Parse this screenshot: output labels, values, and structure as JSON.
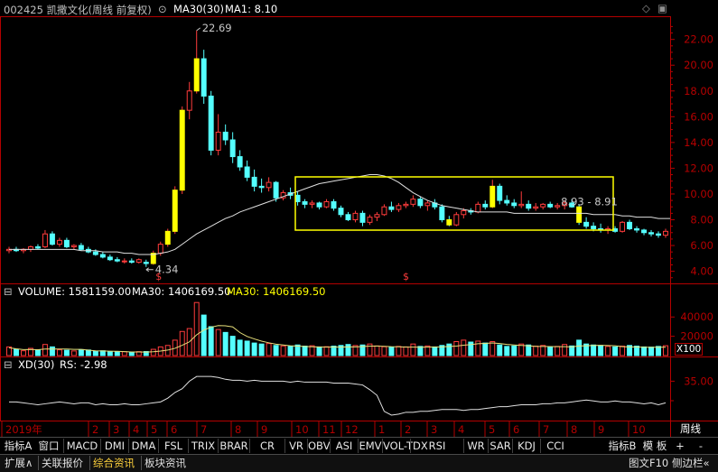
{
  "header": {
    "code": "002425",
    "name": "凯撒文化(周线 前复权)",
    "ma_label": "MA30(30)",
    "ma1_label": "MA1: 8.10"
  },
  "volume_header": {
    "title": "VOLUME: 1581159.00",
    "ma_label": "MA30: 1406169.50",
    "ma_value": "MA30: 1406169.50"
  },
  "xd_header": {
    "title": "XD(30)",
    "rs": "RS: -2.98"
  },
  "annotations": {
    "high": "22.69",
    "low": "4.34",
    "range": "8.93 - 8.91",
    "marker": "$"
  },
  "scale": {
    "vol_unit": "X100",
    "period": "周线"
  },
  "toolbar": {
    "expand": "指标A",
    "window": "窗口",
    "indicators": [
      "MACD",
      "DMI",
      "DMA",
      "FSL",
      "TRIX",
      "BRAR",
      "CR",
      "VR",
      "OBV",
      "ASI",
      "EMV",
      "VOL-TDX",
      "RSI",
      "WR",
      "SAR",
      "KDJ",
      "CCI"
    ],
    "indicator_b": "指标B",
    "template": "模 板",
    "plus": "+",
    "minus": "-"
  },
  "bottom_tabs": {
    "expand": "扩展∧",
    "items": [
      "关联报价",
      "综合资讯",
      "板块资讯"
    ],
    "f10": "图文F10",
    "sidebar": "侧边栏«"
  },
  "colors": {
    "up": "#ff3c3c",
    "down": "#54ffff",
    "ma": "#e0e0e0",
    "ma30_label": "#ffff00",
    "axis": "#b40000",
    "box": "#ffff00"
  },
  "chart_data": [
    {
      "type": "candlestick",
      "title": "002425 凯撒文化(周线 前复权)",
      "ylim": [
        3.2,
        23.8
      ],
      "y_ticks": [
        "22.00",
        "20.00",
        "18.00",
        "16.00",
        "14.00",
        "12.00",
        "10.00",
        "8.00",
        "6.00",
        "4.00"
      ],
      "x_labels": [
        "2019年",
        "2",
        "3",
        "4",
        "5",
        "6",
        "7",
        "8",
        "9",
        "10",
        "11",
        "12",
        "1",
        "2",
        "3",
        "4",
        "5",
        "6",
        "7",
        "8",
        "9",
        "10"
      ],
      "ohlc": [
        [
          5.6,
          5.9,
          5.4,
          5.7
        ],
        [
          5.7,
          5.9,
          5.5,
          5.6
        ],
        [
          5.6,
          5.8,
          5.4,
          5.7
        ],
        [
          5.7,
          6.0,
          5.5,
          5.9
        ],
        [
          5.9,
          6.1,
          5.7,
          5.8
        ],
        [
          5.9,
          7.2,
          5.8,
          6.9
        ],
        [
          6.9,
          7.1,
          6.0,
          6.1
        ],
        [
          6.1,
          6.6,
          5.9,
          6.4
        ],
        [
          6.4,
          6.6,
          5.8,
          5.9
        ],
        [
          5.9,
          6.1,
          5.7,
          6.0
        ],
        [
          6.0,
          6.2,
          5.6,
          5.7
        ],
        [
          5.7,
          5.9,
          5.4,
          5.5
        ],
        [
          5.5,
          5.7,
          5.2,
          5.3
        ],
        [
          5.3,
          5.5,
          5.0,
          5.1
        ],
        [
          5.1,
          5.3,
          4.8,
          4.9
        ],
        [
          4.9,
          5.1,
          4.7,
          4.8
        ],
        [
          4.8,
          5.0,
          4.6,
          4.8
        ],
        [
          4.8,
          5.0,
          4.6,
          4.7
        ],
        [
          4.7,
          5.0,
          4.6,
          4.9
        ],
        [
          4.7,
          4.9,
          4.34,
          4.6
        ],
        [
          4.6,
          5.6,
          4.5,
          5.4
        ],
        [
          5.4,
          6.3,
          5.2,
          6.1
        ],
        [
          6.1,
          7.3,
          5.9,
          7.1
        ],
        [
          7.1,
          10.6,
          6.9,
          10.3
        ],
        [
          10.3,
          16.8,
          10.0,
          16.5
        ],
        [
          16.5,
          18.7,
          15.8,
          18.0
        ],
        [
          18.0,
          22.69,
          17.8,
          20.5
        ],
        [
          20.5,
          21.2,
          17.0,
          17.6
        ],
        [
          17.6,
          18.0,
          13.0,
          13.4
        ],
        [
          13.4,
          16.2,
          13.0,
          14.8
        ],
        [
          14.8,
          15.4,
          13.8,
          14.2
        ],
        [
          14.2,
          14.8,
          12.4,
          12.9
        ],
        [
          12.9,
          13.4,
          11.8,
          12.1
        ],
        [
          12.1,
          12.6,
          11.0,
          11.3
        ],
        [
          11.3,
          11.9,
          10.2,
          10.6
        ],
        [
          10.6,
          11.2,
          10.1,
          10.5
        ],
        [
          10.5,
          11.3,
          10.2,
          10.9
        ],
        [
          10.9,
          11.0,
          9.4,
          9.7
        ],
        [
          9.7,
          10.3,
          9.5,
          10.1
        ],
        [
          10.1,
          10.5,
          9.6,
          9.9
        ],
        [
          9.9,
          10.2,
          9.1,
          9.4
        ],
        [
          9.4,
          9.6,
          8.9,
          9.2
        ],
        [
          9.2,
          9.5,
          8.9,
          9.3
        ],
        [
          9.3,
          9.4,
          8.8,
          9.0
        ],
        [
          9.0,
          9.6,
          8.9,
          9.4
        ],
        [
          9.4,
          9.6,
          8.7,
          8.9
        ],
        [
          8.9,
          9.1,
          8.2,
          8.4
        ],
        [
          8.4,
          8.6,
          7.9,
          8.0
        ],
        [
          8.0,
          8.7,
          7.8,
          8.5
        ],
        [
          8.5,
          8.7,
          7.5,
          7.8
        ],
        [
          7.8,
          8.4,
          7.6,
          8.2
        ],
        [
          8.2,
          8.6,
          7.9,
          8.4
        ],
        [
          8.4,
          9.2,
          8.3,
          9.0
        ],
        [
          9.0,
          9.4,
          8.6,
          8.8
        ],
        [
          8.8,
          9.3,
          8.6,
          9.1
        ],
        [
          9.1,
          9.4,
          8.9,
          9.2
        ],
        [
          9.2,
          9.9,
          9.0,
          9.6
        ],
        [
          9.6,
          9.8,
          8.9,
          9.1
        ],
        [
          9.1,
          9.5,
          8.7,
          9.3
        ],
        [
          9.3,
          9.6,
          8.8,
          9.0
        ],
        [
          9.0,
          9.2,
          7.8,
          8.0
        ],
        [
          8.0,
          8.3,
          7.5,
          7.6
        ],
        [
          7.6,
          8.6,
          7.5,
          8.4
        ],
        [
          8.4,
          8.9,
          8.1,
          8.7
        ],
        [
          8.7,
          8.9,
          8.4,
          8.6
        ],
        [
          8.6,
          9.4,
          8.5,
          9.2
        ],
        [
          9.2,
          9.5,
          8.8,
          9.0
        ],
        [
          9.0,
          11.1,
          8.9,
          10.6
        ],
        [
          10.6,
          10.8,
          9.2,
          9.5
        ],
        [
          9.5,
          9.9,
          9.1,
          9.3
        ],
        [
          9.3,
          9.6,
          8.9,
          9.1
        ],
        [
          9.1,
          10.2,
          8.9,
          9.2
        ],
        [
          9.2,
          9.5,
          8.7,
          8.9
        ],
        [
          8.9,
          9.3,
          8.7,
          9.0
        ],
        [
          9.0,
          9.3,
          8.8,
          9.2
        ],
        [
          9.2,
          9.4,
          8.9,
          9.0
        ],
        [
          9.0,
          9.3,
          8.8,
          9.1
        ],
        [
          9.1,
          9.5,
          8.8,
          9.3
        ],
        [
          9.3,
          9.6,
          8.93,
          9.0
        ],
        [
          9.0,
          9.2,
          7.6,
          7.8
        ],
        [
          7.8,
          8.2,
          7.3,
          7.5
        ],
        [
          7.5,
          7.8,
          7.1,
          7.3
        ],
        [
          7.3,
          7.7,
          7.0,
          7.2
        ],
        [
          7.2,
          7.5,
          6.9,
          7.3
        ],
        [
          7.3,
          7.5,
          7.0,
          7.1
        ],
        [
          7.1,
          7.9,
          7.0,
          7.8
        ],
        [
          7.8,
          8.0,
          7.2,
          7.3
        ],
        [
          7.3,
          7.5,
          7.0,
          7.2
        ],
        [
          7.2,
          7.3,
          6.8,
          7.0
        ],
        [
          7.0,
          7.2,
          6.7,
          6.9
        ],
        [
          6.9,
          7.1,
          6.6,
          6.8
        ],
        [
          6.8,
          7.3,
          6.6,
          7.1
        ]
      ],
      "series": [
        {
          "name": "MA30(30)",
          "values": [
            5.7,
            5.7,
            5.7,
            5.7,
            5.7,
            5.7,
            5.7,
            5.7,
            5.7,
            5.7,
            5.6,
            5.6,
            5.6,
            5.5,
            5.5,
            5.5,
            5.4,
            5.4,
            5.3,
            5.3,
            5.3,
            5.4,
            5.5,
            5.7,
            6.1,
            6.5,
            6.9,
            7.2,
            7.5,
            7.8,
            8.1,
            8.3,
            8.6,
            8.8,
            9.0,
            9.2,
            9.4,
            9.6,
            9.8,
            10.0,
            10.2,
            10.4,
            10.6,
            10.8,
            10.9,
            11.0,
            11.1,
            11.2,
            11.3,
            11.4,
            11.5,
            11.5,
            11.4,
            11.2,
            10.9,
            10.5,
            10.1,
            9.8,
            9.5,
            9.3,
            9.1,
            9.0,
            8.9,
            8.8,
            8.7,
            8.6,
            8.6,
            8.6,
            8.6,
            8.6,
            8.5,
            8.5,
            8.5,
            8.5,
            8.5,
            8.5,
            8.5,
            8.5,
            8.5,
            8.5,
            8.5,
            8.4,
            8.4,
            8.4,
            8.4,
            8.3,
            8.3,
            8.2,
            8.2,
            8.2,
            8.1,
            8.1
          ]
        }
      ],
      "annotations": [
        {
          "label": "22.69",
          "x_index": 26,
          "y": 22.69
        },
        {
          "label": "4.34",
          "x_index": 19,
          "y": 4.34
        },
        {
          "label": "8.93 - 8.91",
          "x_index": 78,
          "y": 9.4
        }
      ]
    },
    {
      "type": "bar",
      "title": "VOLUME",
      "y_ticks": [
        "40000",
        "20000"
      ],
      "unit": "X100",
      "values": [
        9000,
        6500,
        5000,
        7500,
        6000,
        11500,
        9000,
        6000,
        5500,
        4800,
        6200,
        5800,
        4500,
        5000,
        4200,
        3800,
        4000,
        3600,
        4100,
        4200,
        6500,
        9000,
        10500,
        16000,
        25000,
        28000,
        55000,
        42000,
        30000,
        27000,
        24000,
        20000,
        16000,
        15000,
        13000,
        12000,
        12500,
        10500,
        10000,
        9500,
        11000,
        9800,
        10200,
        9000,
        9200,
        9800,
        10500,
        11500,
        10400,
        11000,
        12000,
        10000,
        9200,
        8800,
        9500,
        9000,
        12000,
        9500,
        10000,
        9000,
        10500,
        12000,
        14500,
        16000,
        14000,
        15000,
        13000,
        14500,
        11000,
        9500,
        10000,
        12000,
        11000,
        9800,
        10500,
        9000,
        9500,
        11500,
        10000,
        16000,
        12000,
        11000,
        10500,
        9500,
        9000,
        9800,
        10500,
        9800,
        9000,
        8800,
        9500,
        10200
      ],
      "ma": 14061.7
    },
    {
      "type": "line",
      "title": "XD(30)",
      "y_ticks": [
        "35.00"
      ],
      "series": [
        {
          "name": "XD(30)",
          "values": [
            13,
            13,
            12,
            11,
            10,
            11,
            12,
            13,
            12,
            11,
            12,
            12,
            10,
            11,
            10,
            10,
            11,
            10,
            10,
            11,
            12,
            13,
            17,
            23,
            27,
            35,
            40,
            40,
            40,
            39,
            37,
            36,
            36,
            35,
            36,
            35,
            35,
            35,
            35,
            34,
            35,
            34,
            34,
            34,
            34,
            33,
            33,
            33,
            32,
            31,
            26,
            20,
            3,
            -1,
            0,
            2,
            2,
            3,
            3,
            4,
            5,
            5,
            5,
            4,
            5,
            5,
            6,
            7,
            8,
            8,
            9,
            10,
            10,
            10,
            11,
            11,
            12,
            12,
            13,
            14,
            15,
            14,
            13,
            13,
            14,
            13,
            13,
            12,
            11,
            12,
            10,
            12
          ]
        }
      ]
    }
  ]
}
